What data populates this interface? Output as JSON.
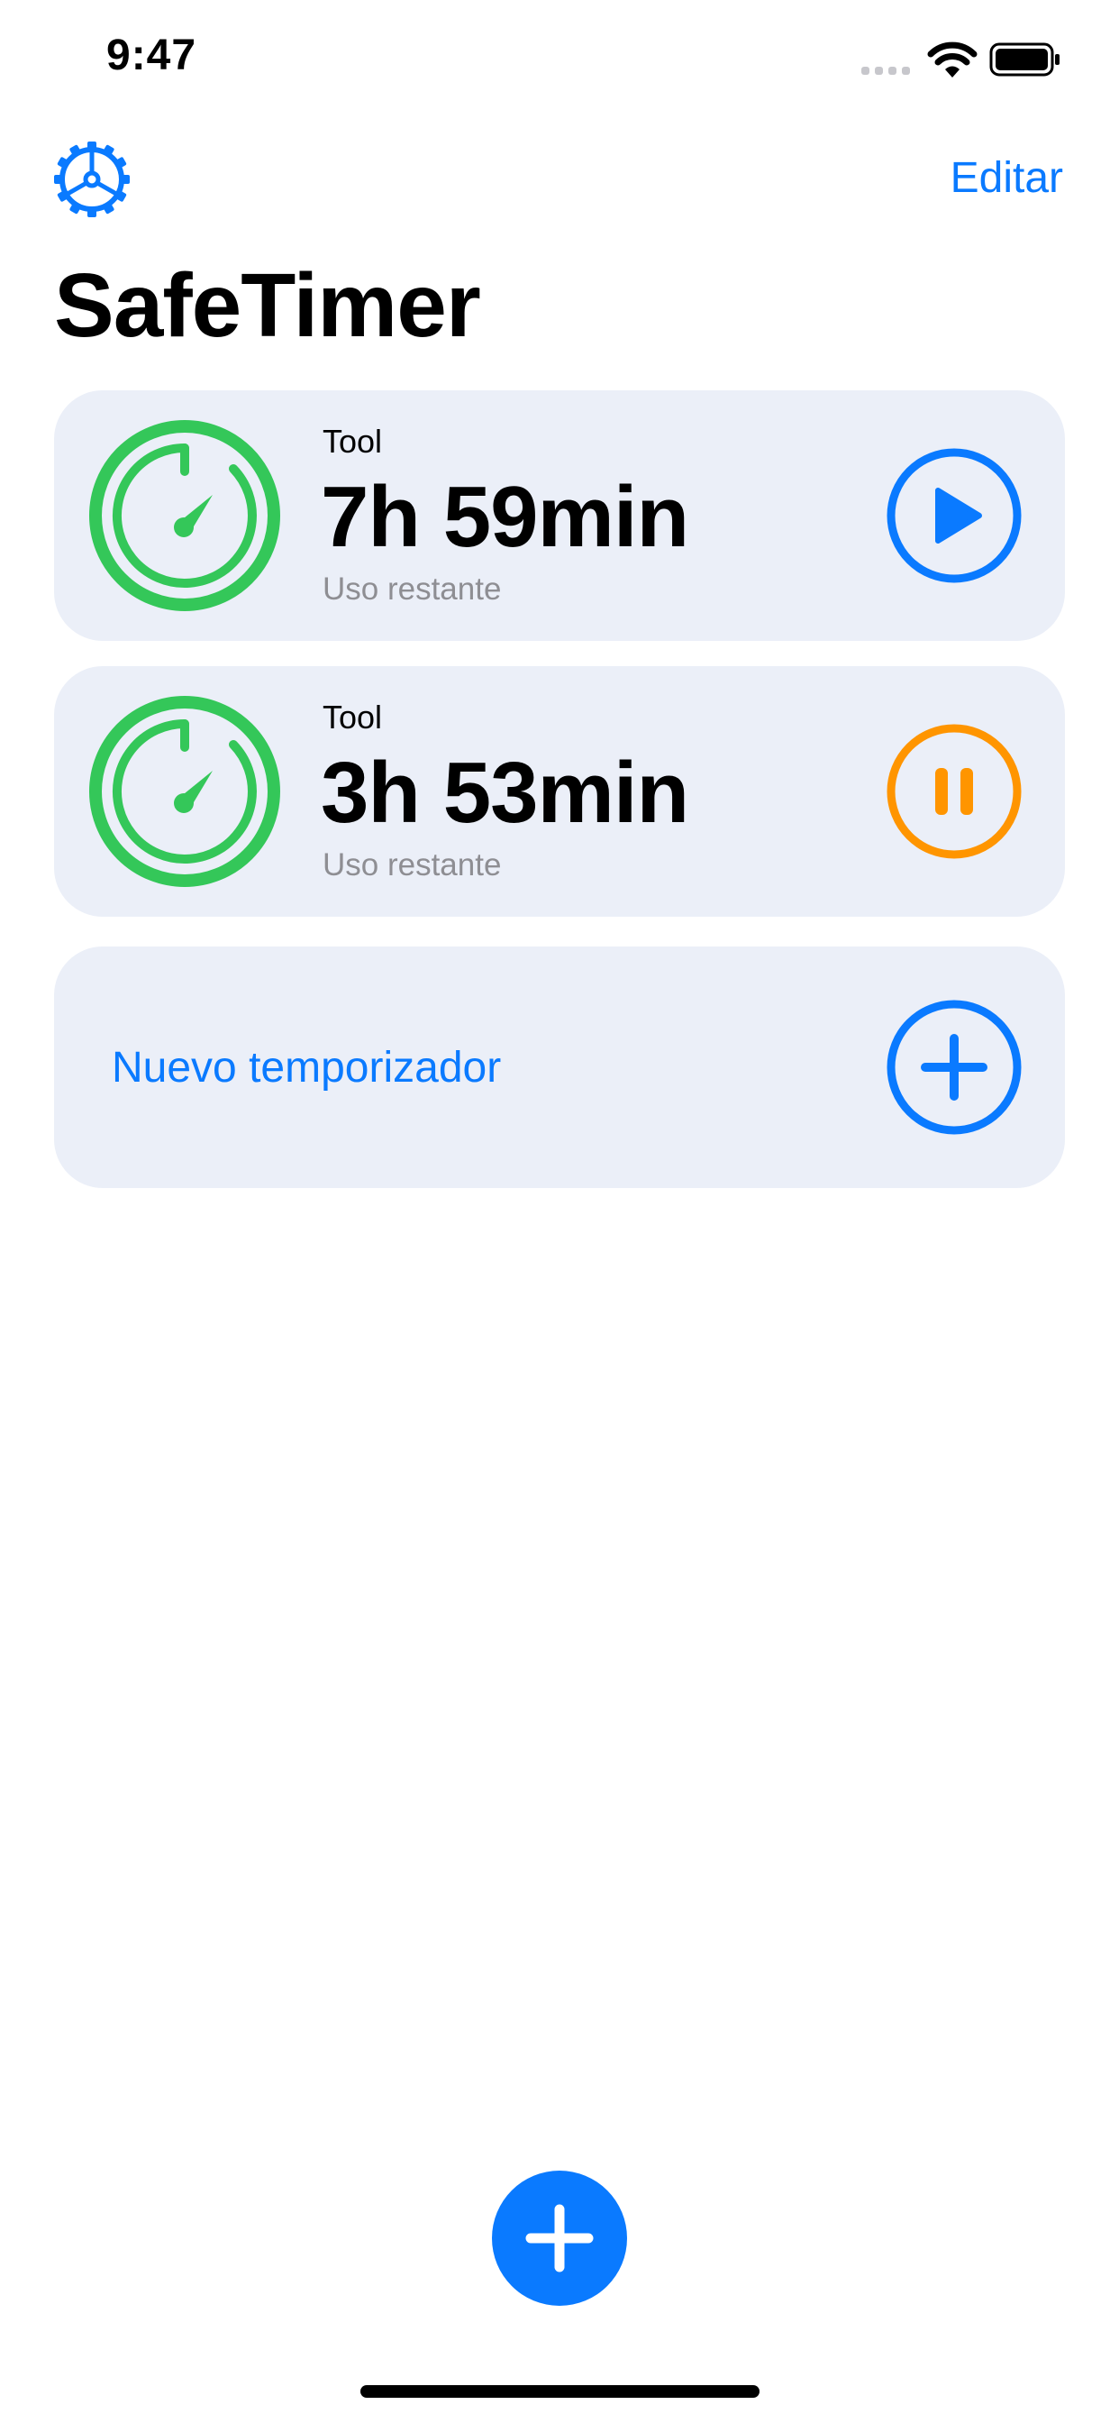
{
  "status_bar": {
    "time": "9:47",
    "icons": [
      "signal-icon",
      "wifi-icon",
      "battery-icon"
    ]
  },
  "nav": {
    "settings_icon": "gear-icon",
    "edit_label": "Editar"
  },
  "title": "SafeTimer",
  "timers": [
    {
      "name": "Tool",
      "remaining": "7h 59min",
      "subtitle": "Uso restante",
      "action_icon": "play-icon",
      "action_color": "#0a7aff",
      "ring_color": "#34c759"
    },
    {
      "name": "Tool",
      "remaining": "3h 53min",
      "subtitle": "Uso restante",
      "action_icon": "pause-icon",
      "action_color": "#ff9500",
      "ring_color": "#34c759"
    }
  ],
  "new_timer": {
    "label": "Nuevo temporizador",
    "icon": "plus-circle-icon"
  },
  "fab": {
    "icon": "plus-icon",
    "color": "#0a7aff"
  },
  "colors": {
    "accent": "#0a7aff",
    "card_background": "#ebeff8",
    "secondary_text": "#8e8e93"
  }
}
